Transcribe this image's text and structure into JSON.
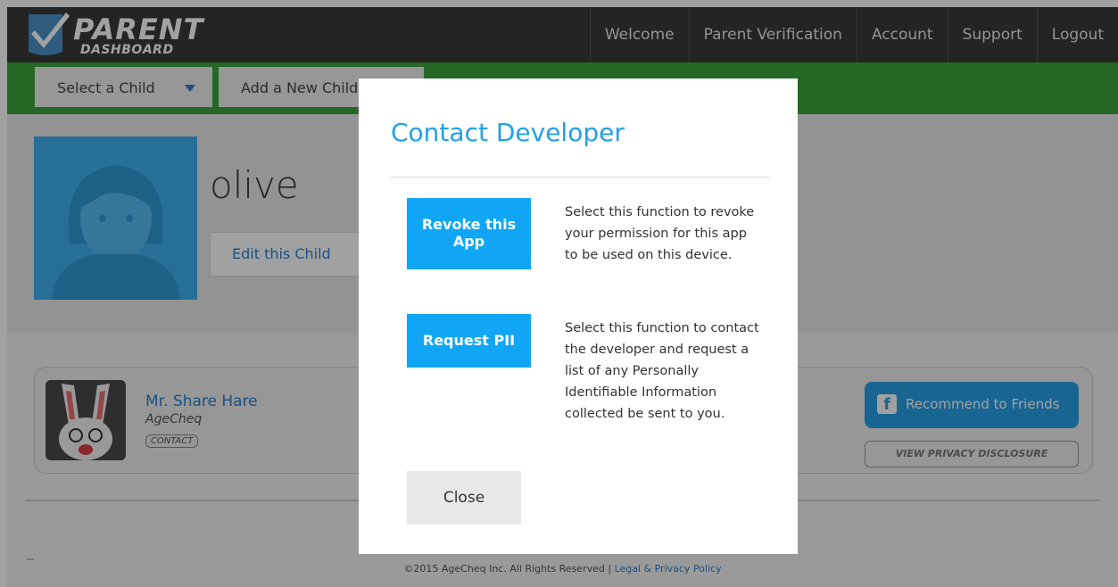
{
  "brand": {
    "title": "PARENT",
    "subtitle": "DASHBOARD"
  },
  "nav": {
    "welcome": "Welcome",
    "verification": "Parent Verification",
    "account": "Account",
    "support": "Support",
    "logout": "Logout"
  },
  "subnav": {
    "select_child": "Select a Child",
    "add_child": "Add a New Child"
  },
  "child": {
    "name": "olive",
    "edit_label": "Edit this Child"
  },
  "app": {
    "name": "Mr. Share Hare",
    "developer": "AgeCheq",
    "contact_label": "CONTACT",
    "recommend_label": "Recommend to Friends",
    "privacy_label": "VIEW PRIVACY DISCLOSURE"
  },
  "footer": {
    "text": "©2015 AgeCheq Inc. All Rights Reserved | ",
    "link": "Legal & Privacy Policy"
  },
  "modal": {
    "title": "Contact Developer",
    "revoke_label_line1": "Revoke this",
    "revoke_label_line2": "App",
    "revoke_desc": "Select this function to revoke your permission for this app to be used on this device.",
    "pii_label": "Request PII",
    "pii_desc": "Select this function to contact the developer and request a list of any Personally Identifiable Information collected be sent to you.",
    "close_label": "Close"
  },
  "colors": {
    "topbar": "#3a3a3a",
    "green": "#3ca53c",
    "accent_blue": "#22a0e8",
    "button_blue": "#10a6f5"
  },
  "icons": [
    "checkmark-logo-icon",
    "dropdown-triangle-icon",
    "avatar-silhouette-icon",
    "hare-app-icon",
    "facebook-icon"
  ]
}
